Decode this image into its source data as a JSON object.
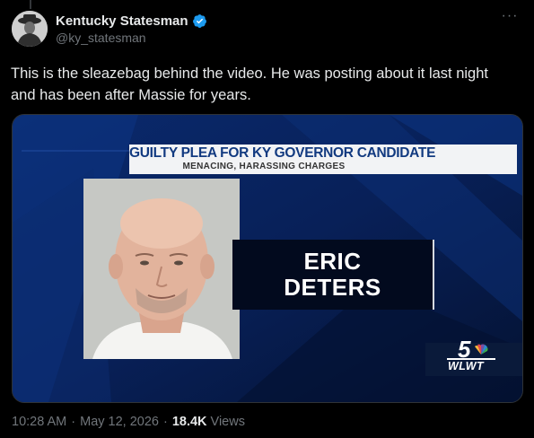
{
  "author": {
    "display_name": "Kentucky Statesman",
    "handle": "@ky_statesman",
    "verified": true
  },
  "tweet": {
    "text_line1": "This is the sleazebag behind the video. He was posting about it last night",
    "text_line2": "and has been after Massie for years.",
    "time": "10:28 AM",
    "date": "May 12, 2026",
    "separator": "·",
    "views_count": "18.4K",
    "views_label": "Views"
  },
  "media": {
    "chyron_title": "GUILTY PLEA FOR KY GOVERNOR CANDIDATE",
    "chyron_subtitle": "MENACING, HARASSING CHARGES",
    "name_line1": "ERIC",
    "name_line2": "DETERS",
    "station_logo_number": "5",
    "station_logo_text": "WLWT"
  },
  "colors": {
    "background": "#000000",
    "text_primary": "#e7e9ea",
    "text_secondary": "#71767b",
    "verified_blue": "#1d9bf0",
    "broadcast_navy": "#061844",
    "chyron_blue": "#123a80"
  }
}
